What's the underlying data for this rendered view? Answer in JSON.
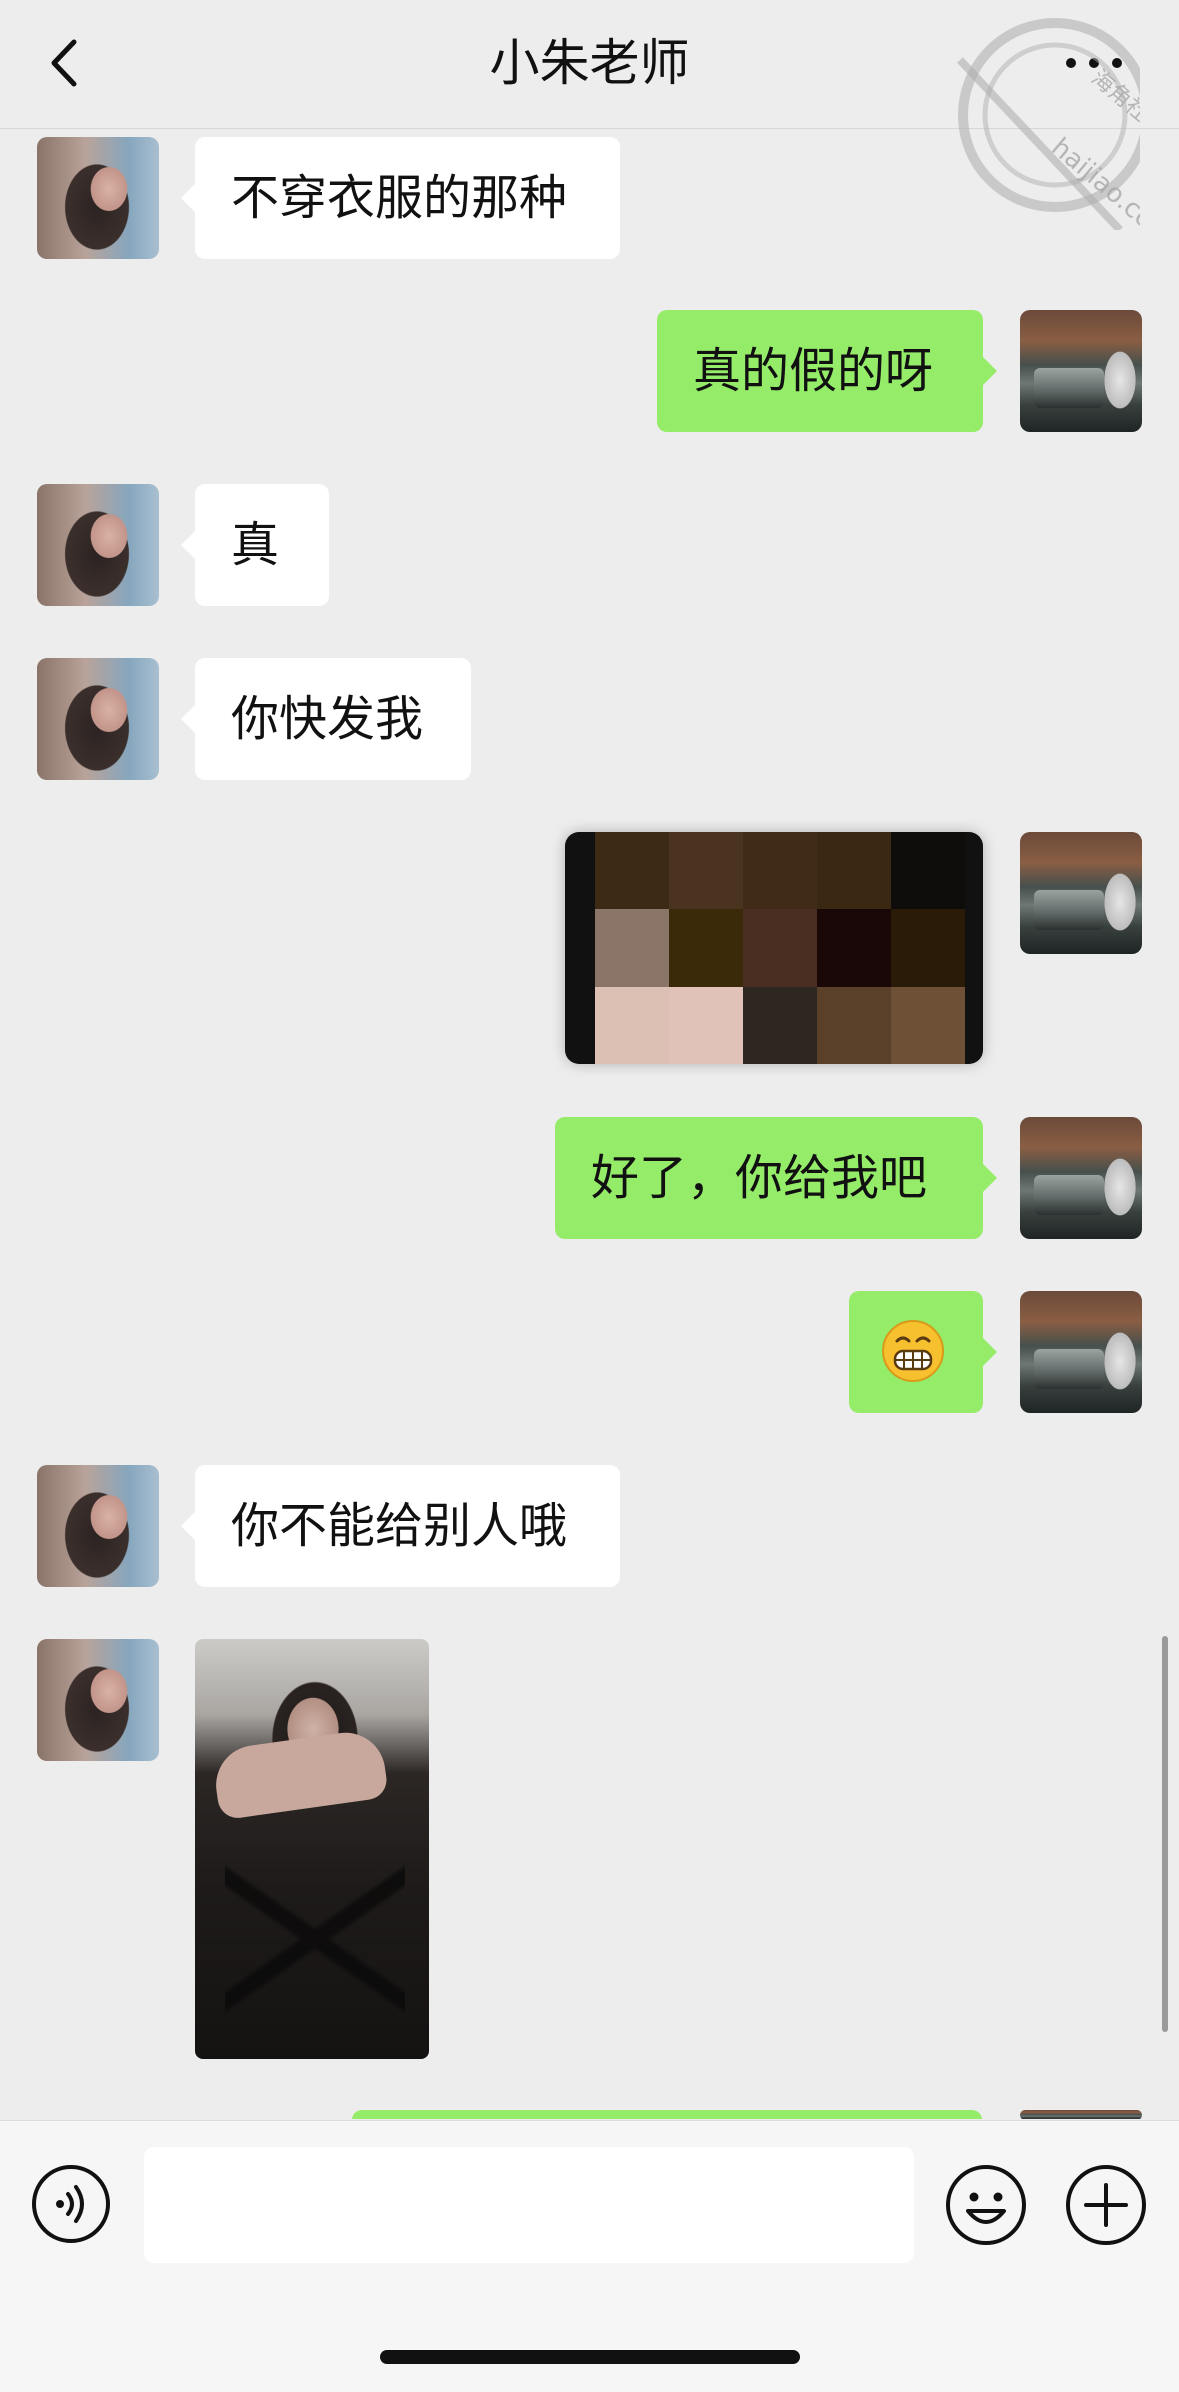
{
  "header": {
    "title": "小朱老师",
    "back_icon": "chevron-left-icon",
    "more_icon": "more-dots-icon"
  },
  "watermark": {
    "text": "haijiao.com",
    "text_cn": "海角社区"
  },
  "messages": [
    {
      "side": "left",
      "text": "不穿衣服的那种"
    },
    {
      "side": "right",
      "text": "真的假的呀"
    },
    {
      "side": "left",
      "text": "真"
    },
    {
      "side": "left",
      "text": "你快发我"
    },
    {
      "side": "right",
      "type": "image",
      "description": "pixelated image"
    },
    {
      "side": "right",
      "text": "好了，你给我吧"
    },
    {
      "side": "right",
      "type": "emoji",
      "emoji": "grinning-face-emoji"
    },
    {
      "side": "left",
      "text": "你不能给别人哦"
    },
    {
      "side": "left",
      "type": "image",
      "description": "photo"
    }
  ],
  "pixel_colors": [
    "#3d2a14",
    "#4a3420",
    "#3f2b17",
    "#3a2812",
    "#0e0d0c",
    "#8a7568",
    "#3a2a0a",
    "#4a2e22",
    "#1a0808",
    "#2a1a08",
    "#dcc0b4",
    "#e0c2b8",
    "#2e2620",
    "#5a4028",
    "#6e5036"
  ],
  "input_bar": {
    "voice_icon": "voice-icon",
    "input_value": "",
    "emoji_icon": "emoji-smile-icon",
    "plus_icon": "plus-circle-icon"
  },
  "colors": {
    "self_bubble": "#95ec69",
    "other_bubble": "#ffffff",
    "background": "#ededed"
  }
}
